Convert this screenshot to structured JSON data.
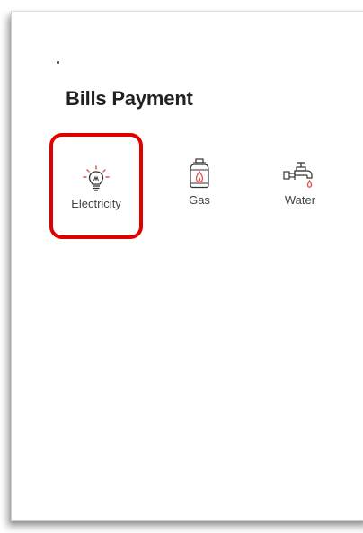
{
  "section": {
    "title": "Bills Payment"
  },
  "categories": [
    {
      "label": "Electricity",
      "icon": "lightbulb-icon",
      "selected": true
    },
    {
      "label": "Gas",
      "icon": "gas-cylinder-icon",
      "selected": false
    },
    {
      "label": "Water",
      "icon": "water-tap-icon",
      "selected": false
    }
  ],
  "colors": {
    "highlight": "#e00000",
    "icon_accent": "#e0504a",
    "text": "#222222"
  }
}
